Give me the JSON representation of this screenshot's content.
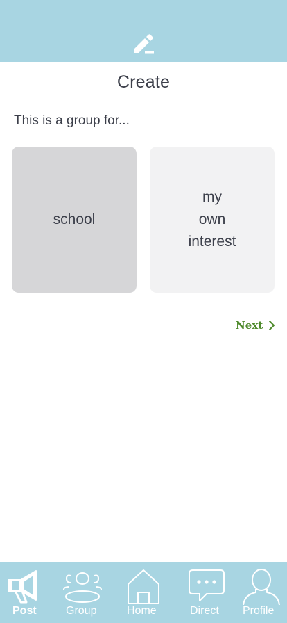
{
  "header": {
    "icon": "edit-icon"
  },
  "page": {
    "title": "Create",
    "prompt": "This is a group for..."
  },
  "choices": [
    {
      "label_lines": [
        "school"
      ],
      "label": "school",
      "selected": true
    },
    {
      "label_lines": [
        "my",
        "own",
        "interest"
      ],
      "label": "my own interest",
      "selected": false
    }
  ],
  "next": {
    "label": "Next",
    "icon": "chevron-right-icon"
  },
  "bottom_nav": {
    "items": [
      {
        "label": "Post",
        "icon": "megaphone-icon",
        "active": true
      },
      {
        "label": "Group",
        "icon": "group-icon",
        "active": false
      },
      {
        "label": "Home",
        "icon": "home-icon",
        "active": false
      },
      {
        "label": "Direct",
        "icon": "chat-bubble-icon",
        "active": false
      },
      {
        "label": "Profile",
        "icon": "profile-icon",
        "active": false
      }
    ]
  },
  "colors": {
    "bar": "#a8d5e2",
    "text": "#3c3f4a",
    "next": "#4e8a2c",
    "choice_selected": "#d6d6d8",
    "choice_default": "#f2f2f3"
  }
}
